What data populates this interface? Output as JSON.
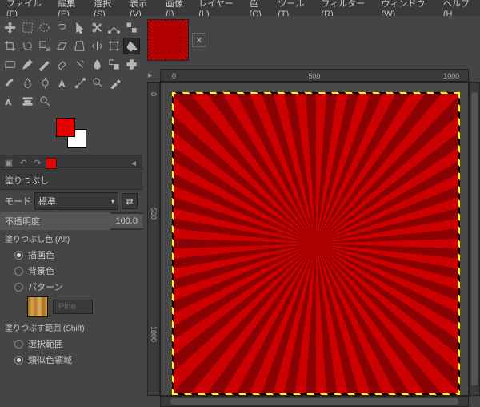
{
  "menu": {
    "file": "ファイル(F)",
    "edit": "編集(E)",
    "select": "選択(S)",
    "view": "表示(V)",
    "image": "画像(I)",
    "layer": "レイヤー(L)",
    "color": "色(C)",
    "tool": "ツール(T)",
    "filter": "フィルター(R)",
    "window": "ウィンドウ(W)",
    "help": "ヘルプ(H"
  },
  "tab": {
    "close": "✕"
  },
  "ruler": {
    "h0": "0",
    "h1": "500",
    "h2": "1000",
    "v0": "0",
    "v1": "500",
    "v2": "1000"
  },
  "dock": {
    "title": "塗りつぶし",
    "mode_label": "モード",
    "mode_value": "標準",
    "opacity_label": "不透明度",
    "opacity_value": "100.0",
    "fillcolor_hdr": "塗りつぶし色 (Alt)",
    "fg": "描画色",
    "bg": "背景色",
    "pattern": "パターン",
    "pattern_name": "Pine",
    "area_hdr": "塗りつぶす範囲 (Shift)",
    "sel": "選択範囲",
    "sim": "類似色領域"
  }
}
